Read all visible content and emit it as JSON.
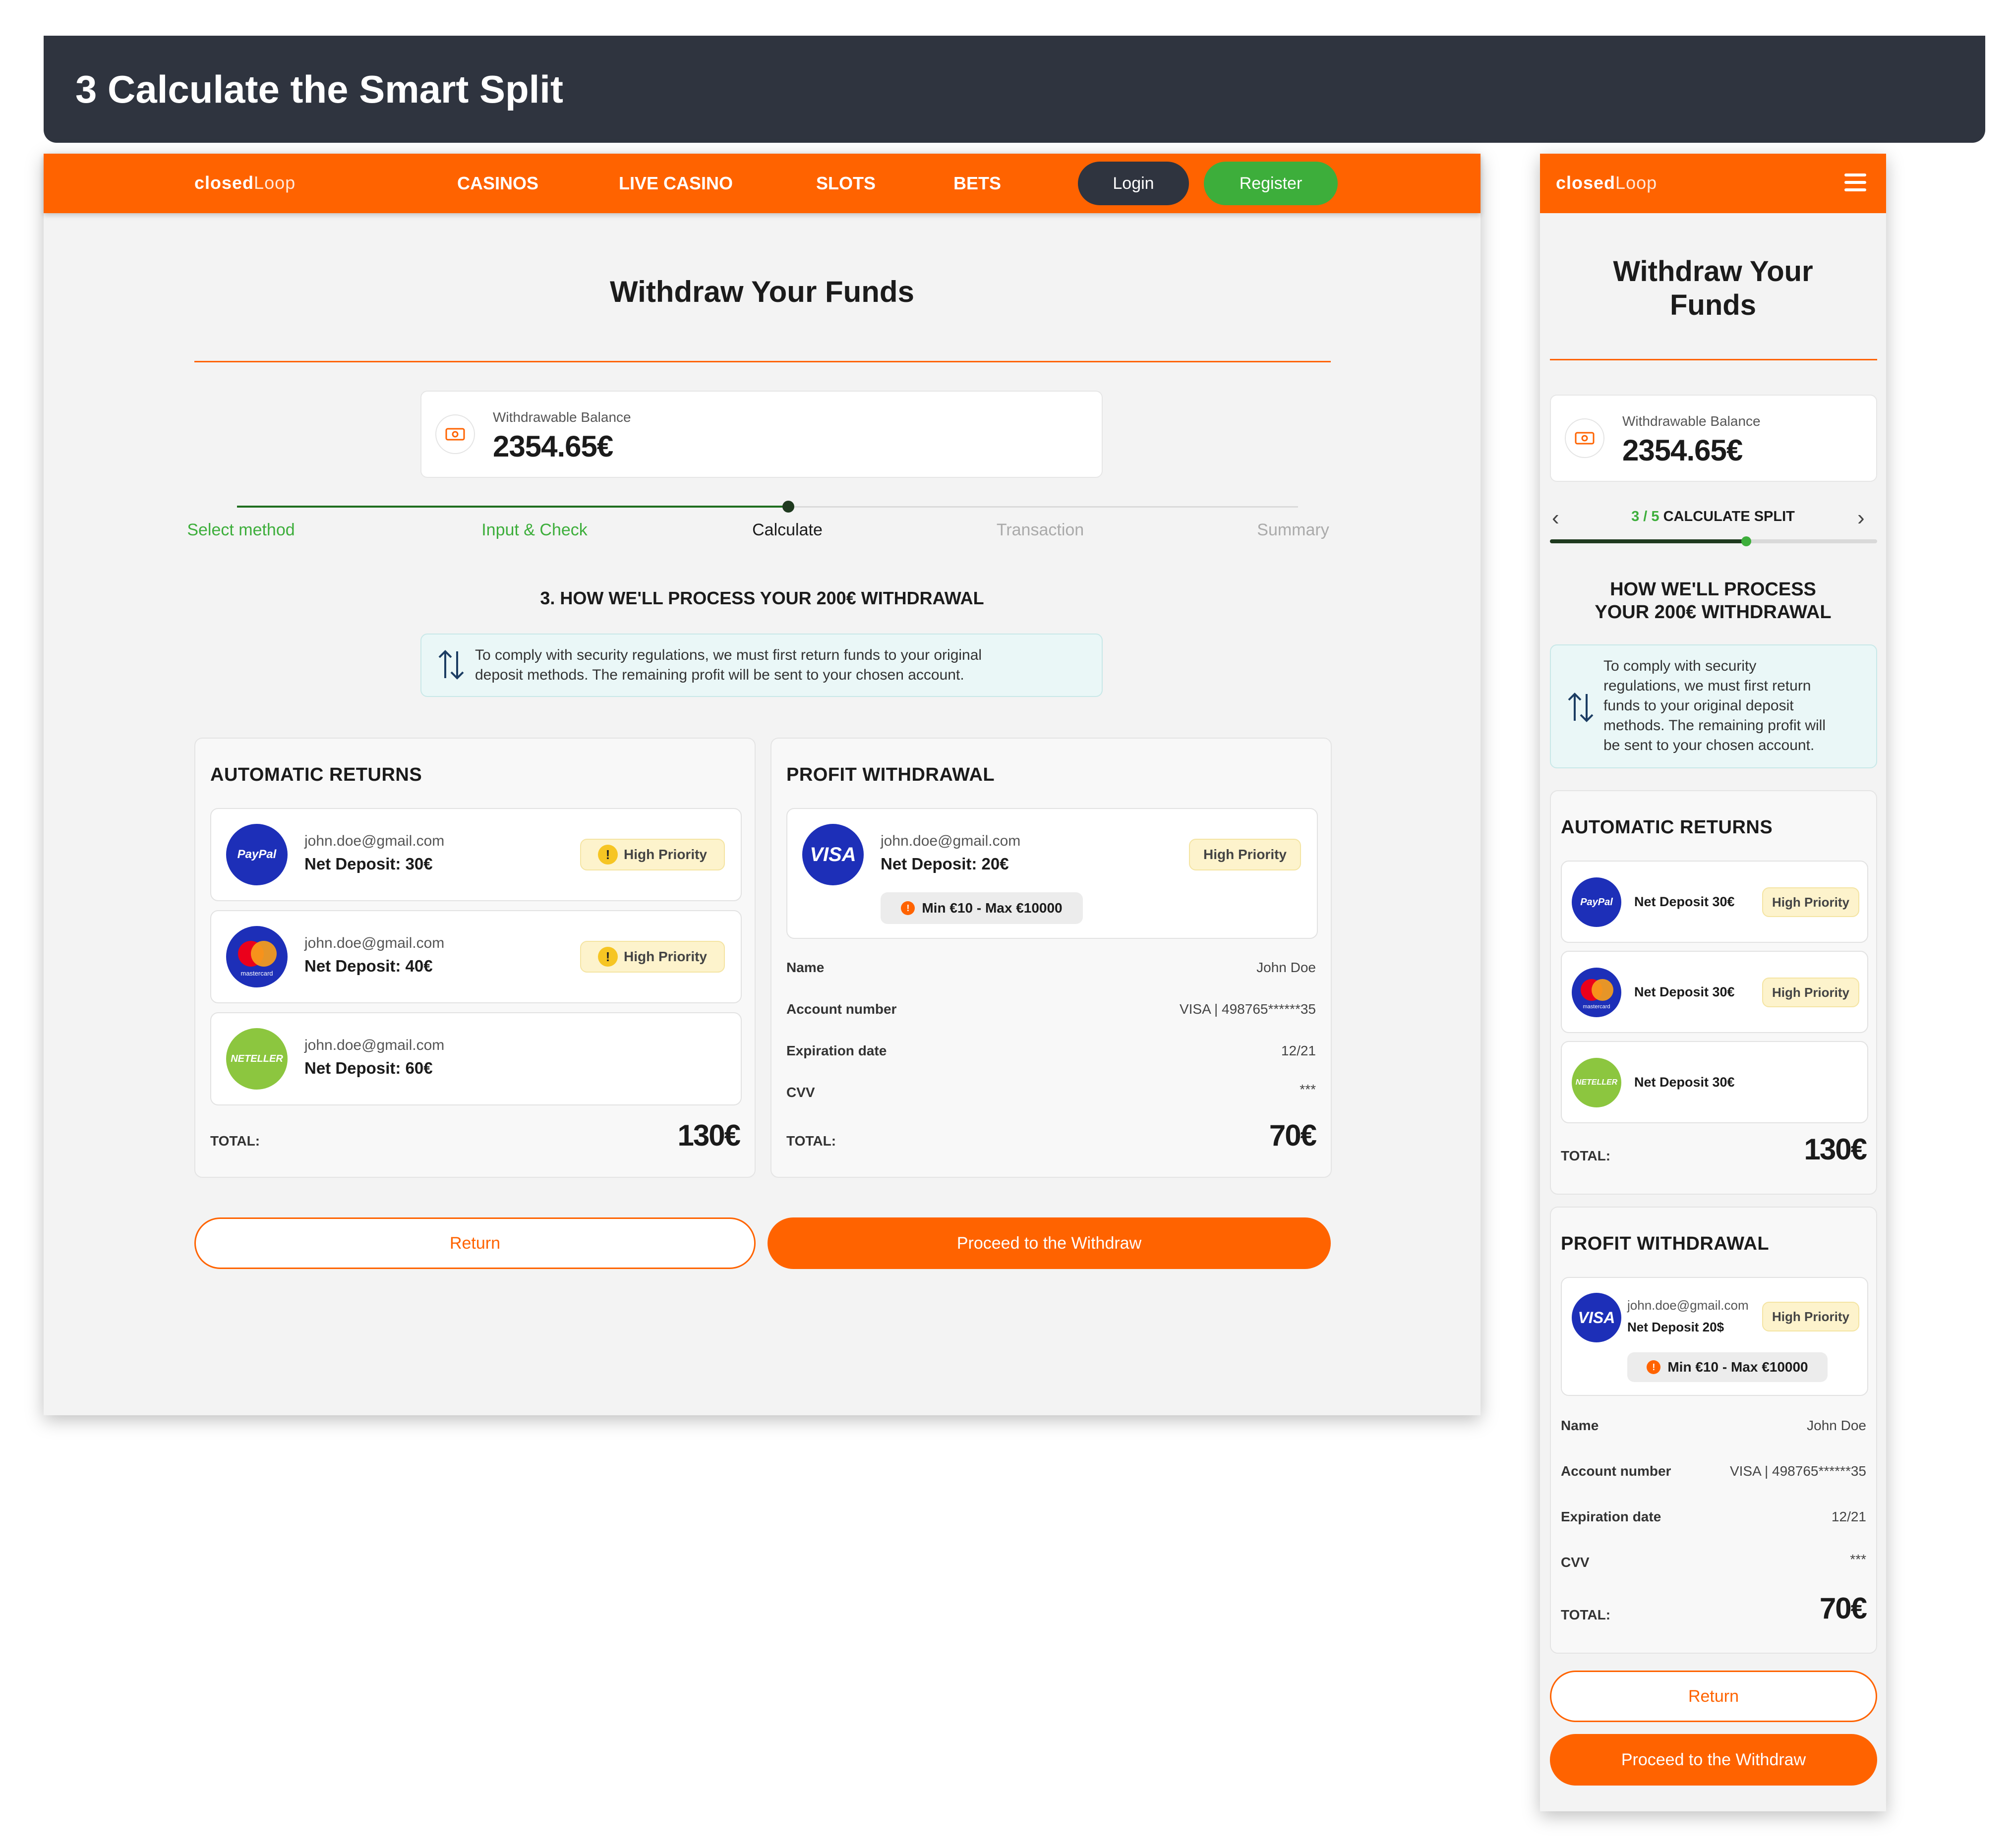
{
  "banner": {
    "title": "3 Calculate the Smart Split"
  },
  "brand": {
    "logo_part1": "closed",
    "logo_part2": "Loop",
    "accent": "#ff6300",
    "green": "#3dae3b",
    "dark": "#2f343f"
  },
  "nav": {
    "links": [
      "CASINOS",
      "LIVE CASINO",
      "SLOTS",
      "BETS"
    ],
    "login": "Login",
    "register": "Register"
  },
  "page": {
    "title": "Withdraw Your Funds",
    "title_line1": "Withdraw Your",
    "title_line2": "Funds"
  },
  "balance": {
    "label": "Withdrawable Balance",
    "value": "2354.65€",
    "icon": "banknote-icon"
  },
  "steps": {
    "items": [
      "Select method",
      "Input & Check",
      "Calculate",
      "Transaction",
      "Summary"
    ],
    "current": 3,
    "total": 5,
    "mobile_counter": "3 / 5",
    "mobile_label": "CALCULATE SPLIT",
    "progress_fraction": 0.6
  },
  "process": {
    "heading": "3. HOW WE'LL PROCESS YOUR 200€ WITHDRAWAL",
    "mobile_line1": "HOW WE'LL PROCESS",
    "mobile_line2": "YOUR 200€ WITHDRAWAL",
    "info_line1": "To comply with security regulations, we must first return funds to your original",
    "info_line2": "deposit methods. The remaining profit will be sent to your chosen account.",
    "info_m1": "To comply with security",
    "info_m2": "regulations, we must first return",
    "info_m3": "funds to your original deposit",
    "info_m4": "methods. The remaining profit will",
    "info_m5": "be sent to your chosen account."
  },
  "automatic": {
    "title": "AUTOMATIC RETURNS",
    "items": [
      {
        "logo": "PayPal",
        "email": "john.doe@gmail.com",
        "deposit": "Net Deposit: 30€",
        "mobile_deposit": "Net Deposit 30€",
        "badge": "High Priority"
      },
      {
        "logo": "mastercard",
        "email": "john.doe@gmail.com",
        "deposit": "Net Deposit: 40€",
        "mobile_deposit": "Net Deposit 30€",
        "badge": "High Priority"
      },
      {
        "logo": "NETELLER",
        "email": "john.doe@gmail.com",
        "deposit": "Net Deposit: 60€",
        "mobile_deposit": "Net Deposit 30€"
      }
    ],
    "total_label": "TOTAL:",
    "total_value": "130€"
  },
  "profit": {
    "title": "PROFIT WITHDRAWAL",
    "logo": "VISA",
    "email": "john.doe@gmail.com",
    "deposit": "Net Deposit: 20€",
    "mobile_deposit": "Net Deposit 20$",
    "badge": "High Priority",
    "limits": "Min €10 - Max €10000",
    "fields": [
      {
        "label": "Name",
        "value": "John Doe"
      },
      {
        "label": "Account number",
        "value": "VISA | 498765******35"
      },
      {
        "label": "Expiration date",
        "value": "12/21"
      },
      {
        "label": "CVV",
        "value": "***"
      }
    ],
    "total_label": "TOTAL:",
    "total_value": "70€"
  },
  "actions": {
    "return": "Return",
    "proceed": "Proceed to the Withdraw"
  }
}
